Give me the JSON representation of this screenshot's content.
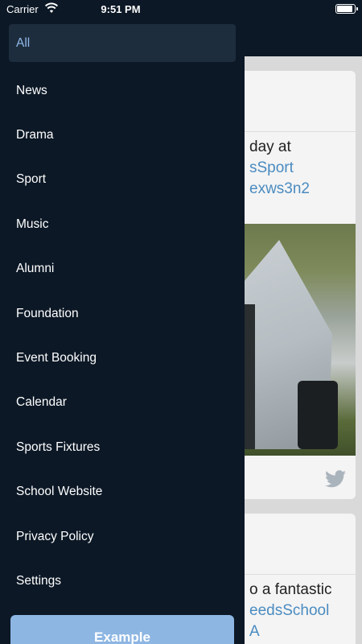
{
  "status_bar": {
    "carrier": "Carrier",
    "time": "9:51 PM"
  },
  "drawer": {
    "menu": [
      {
        "label": "All",
        "active": true
      },
      {
        "label": "News"
      },
      {
        "label": "Drama"
      },
      {
        "label": "Sport"
      },
      {
        "label": "Music"
      },
      {
        "label": "Alumni"
      },
      {
        "label": "Foundation"
      },
      {
        "label": "Event Booking"
      },
      {
        "label": "Calendar"
      },
      {
        "label": "Sports Fixtures"
      },
      {
        "label": "School Website"
      },
      {
        "label": "Privacy Policy"
      },
      {
        "label": "Settings"
      }
    ],
    "footer_button": "Example"
  },
  "feed": {
    "post1": {
      "line1": "day at",
      "line2": "sSport",
      "line3": "exws3n2"
    },
    "post2": {
      "line1": "o a fantastic",
      "line2": "eedsSchool",
      "line3": "A"
    }
  },
  "colors": {
    "drawer_bg": "#0c1826",
    "active_item_bg": "#1e2d3e",
    "active_item_text": "#8fb8e8",
    "button_bg": "#8db6e3",
    "link": "#4a8bc0"
  },
  "icons": [
    "wifi-icon",
    "battery-icon",
    "twitter-icon"
  ]
}
